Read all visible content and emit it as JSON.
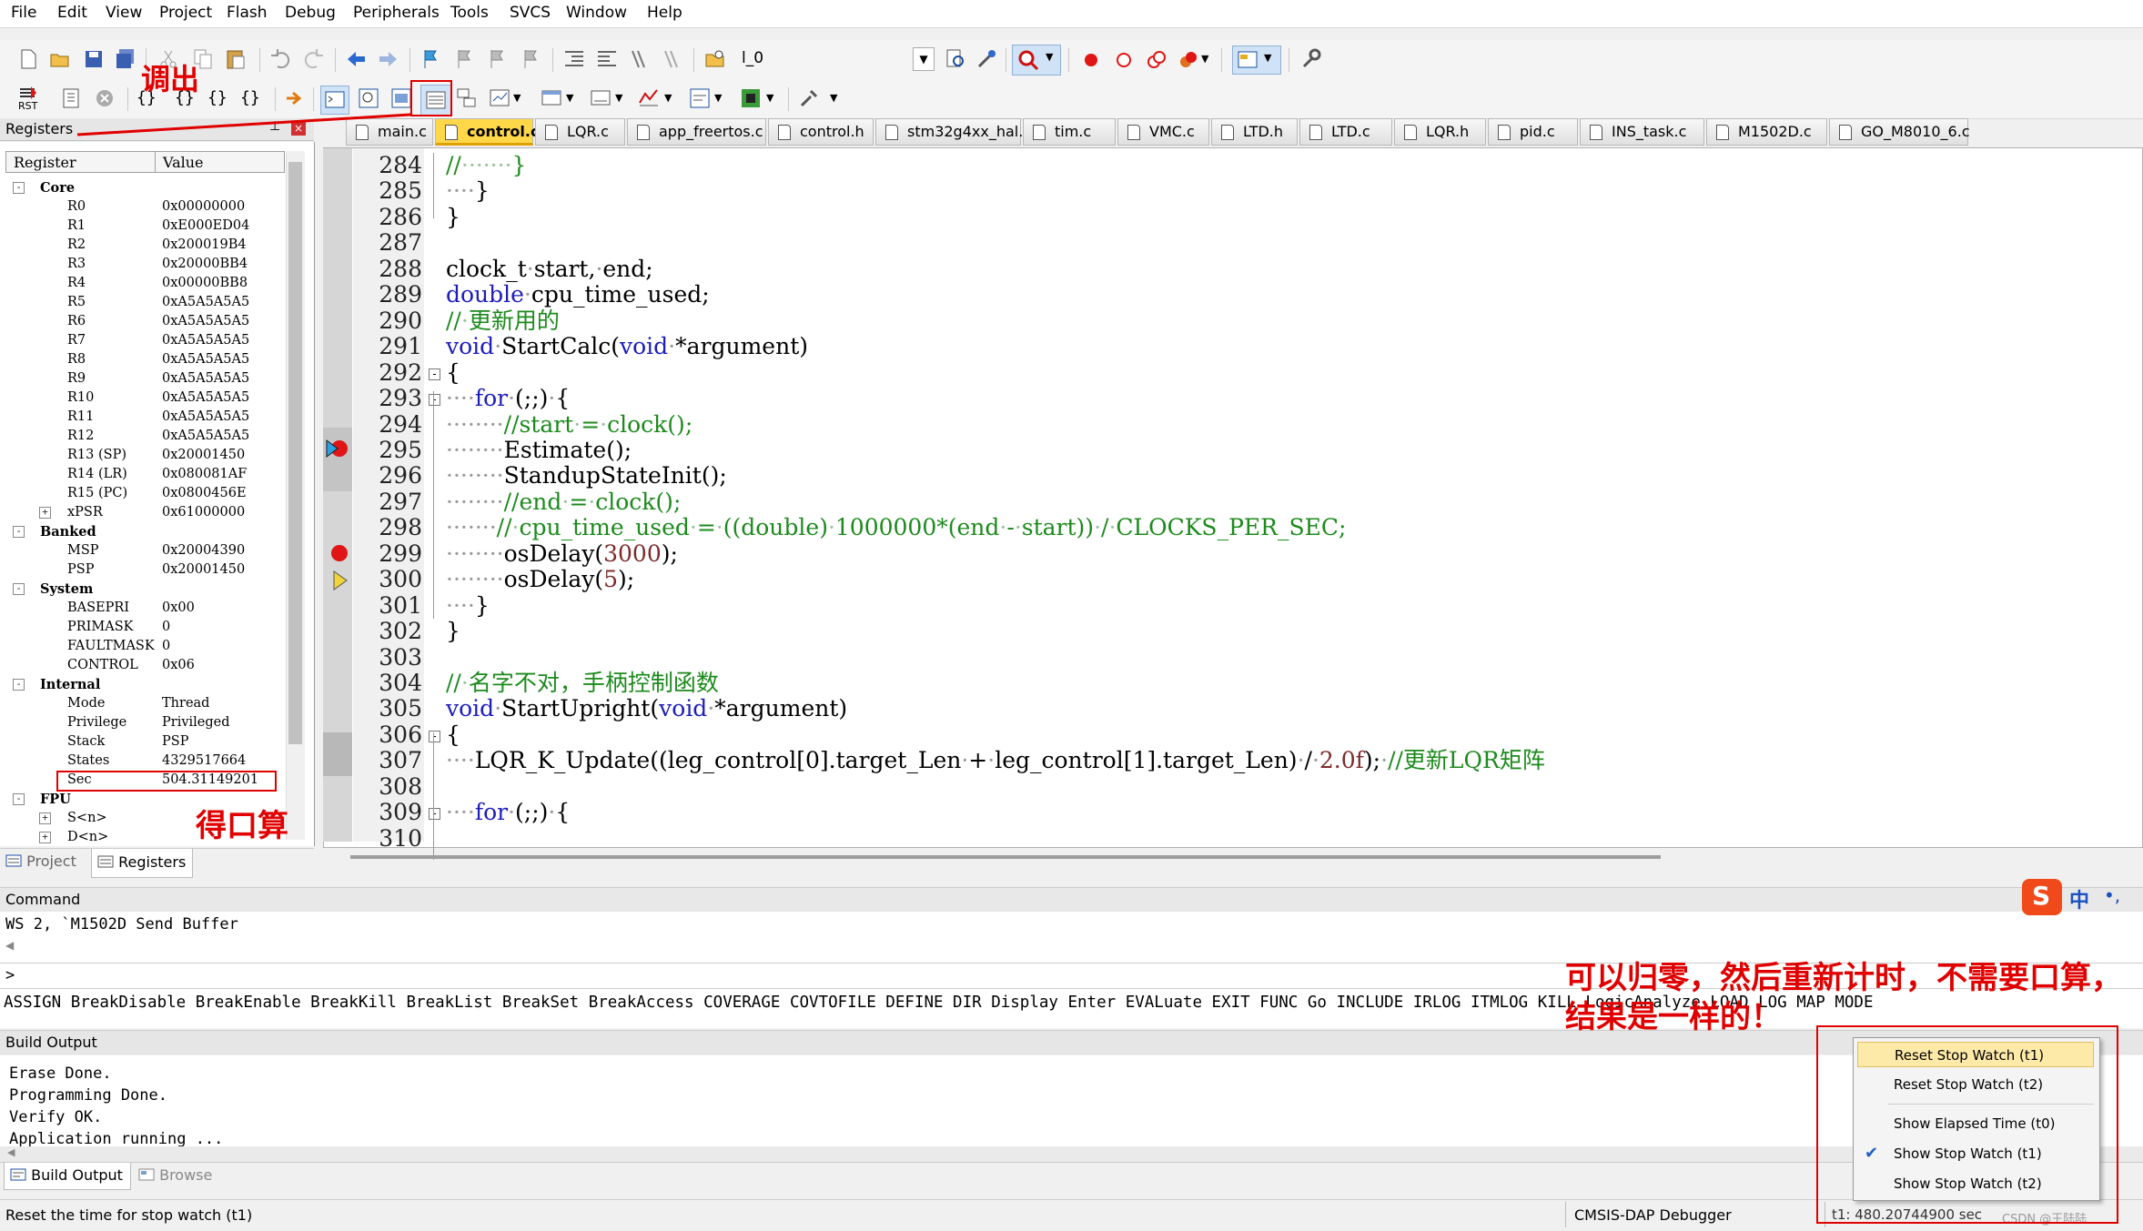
{
  "menu": [
    "File",
    "Edit",
    "View",
    "Project",
    "Flash",
    "Debug",
    "Peripherals",
    "Tools",
    "SVCS",
    "Window",
    "Help"
  ],
  "toolbar": {
    "target_value": "l_0",
    "rst_label": "RST"
  },
  "registers_panel": {
    "title": "Registers",
    "col_register": "Register",
    "col_value": "Value",
    "groups": [
      {
        "name": "Core"
      },
      {
        "name": "Banked"
      },
      {
        "name": "System"
      },
      {
        "name": "Internal"
      },
      {
        "name": "FPU"
      }
    ],
    "core": [
      {
        "name": "R0",
        "value": "0x00000000"
      },
      {
        "name": "R1",
        "value": "0xE000ED04"
      },
      {
        "name": "R2",
        "value": "0x200019B4"
      },
      {
        "name": "R3",
        "value": "0x20000BB4"
      },
      {
        "name": "R4",
        "value": "0x00000BB8"
      },
      {
        "name": "R5",
        "value": "0xA5A5A5A5"
      },
      {
        "name": "R6",
        "value": "0xA5A5A5A5"
      },
      {
        "name": "R7",
        "value": "0xA5A5A5A5"
      },
      {
        "name": "R8",
        "value": "0xA5A5A5A5"
      },
      {
        "name": "R9",
        "value": "0xA5A5A5A5"
      },
      {
        "name": "R10",
        "value": "0xA5A5A5A5"
      },
      {
        "name": "R11",
        "value": "0xA5A5A5A5"
      },
      {
        "name": "R12",
        "value": "0xA5A5A5A5"
      },
      {
        "name": "R13 (SP)",
        "value": "0x20001450"
      },
      {
        "name": "R14 (LR)",
        "value": "0x080081AF"
      },
      {
        "name": "R15 (PC)",
        "value": "0x0800456E"
      },
      {
        "name": "xPSR",
        "value": "0x61000000"
      }
    ],
    "banked": [
      {
        "name": "MSP",
        "value": "0x20004390"
      },
      {
        "name": "PSP",
        "value": "0x20001450"
      }
    ],
    "system": [
      {
        "name": "BASEPRI",
        "value": "0x00"
      },
      {
        "name": "PRIMASK",
        "value": "0"
      },
      {
        "name": "FAULTMASK",
        "value": "0"
      },
      {
        "name": "CONTROL",
        "value": "0x06"
      }
    ],
    "internal": [
      {
        "name": "Mode",
        "value": "Thread"
      },
      {
        "name": "Privilege",
        "value": "Privileged"
      },
      {
        "name": "Stack",
        "value": "PSP"
      },
      {
        "name": "States",
        "value": "4329517664"
      },
      {
        "name": "Sec",
        "value": "504.31149201"
      }
    ],
    "fpu": [
      {
        "name": "S<n>"
      },
      {
        "name": "D<n>"
      }
    ],
    "tabs": [
      "Project",
      "Registers"
    ]
  },
  "file_tabs": [
    "main.c",
    "control.c",
    "LQR.c",
    "app_freertos.c",
    "control.h",
    "stm32g4xx_hal.c",
    "tim.c",
    "VMC.c",
    "LTD.h",
    "LTD.c",
    "LQR.h",
    "pid.c",
    "INS_task.c",
    "M1502D.c",
    "GO_M8010_6.c"
  ],
  "editor": {
    "lines": [
      {
        "no": "284",
        "text": "//·······}"
      },
      {
        "no": "285",
        "text": "····}"
      },
      {
        "no": "286",
        "text": "}"
      },
      {
        "no": "287",
        "text": ""
      },
      {
        "no": "288",
        "text": "clock_t·start,·end;"
      },
      {
        "no": "289",
        "text": "double·cpu_time_used;"
      },
      {
        "no": "290",
        "text": "//·更新用的"
      },
      {
        "no": "291",
        "text": "void·StartCalc(void·*argument)"
      },
      {
        "no": "292",
        "text": "{"
      },
      {
        "no": "293",
        "text": "····for·(;;)·{"
      },
      {
        "no": "294",
        "text": "········//start·=·clock();"
      },
      {
        "no": "295",
        "text": "········Estimate();"
      },
      {
        "no": "296",
        "text": "········StandupStateInit();"
      },
      {
        "no": "297",
        "text": "········//end·=·clock();"
      },
      {
        "no": "298",
        "text": "·······//·cpu_time_used·=·((double)·1000000*(end·-·start))·/·CLOCKS_PER_SEC;"
      },
      {
        "no": "299",
        "text": "········osDelay(3000);"
      },
      {
        "no": "300",
        "text": "········osDelay(5);"
      },
      {
        "no": "301",
        "text": "····}"
      },
      {
        "no": "302",
        "text": "}"
      },
      {
        "no": "303",
        "text": ""
      },
      {
        "no": "304",
        "text": "//·名字不对，手柄控制函数"
      },
      {
        "no": "305",
        "text": "void·StartUpright(void·*argument)"
      },
      {
        "no": "306",
        "text": "{"
      },
      {
        "no": "307",
        "text": "····LQR_K_Update((leg_control[0].target_Len·+·leg_control[1].target_Len)·/·2.0f);·//更新LQR矩阵"
      },
      {
        "no": "308",
        "text": ""
      },
      {
        "no": "309",
        "text": "····for·(;;)·{"
      },
      {
        "no": "310",
        "text": ""
      }
    ]
  },
  "command": {
    "title": "Command",
    "output": "WS 2, `M1502D Send Buffer",
    "prompt": ">",
    "keywords": "ASSIGN BreakDisable BreakEnable BreakKill BreakList BreakSet BreakAccess COVERAGE COVTOFILE DEFINE DIR Display Enter EVALuate EXIT FUNC Go INCLUDE IRLOG ITMLOG KILL LogicAnalyze LOAD LOG MAP MODE"
  },
  "build_output": {
    "title": "Build Output",
    "lines": [
      "Erase Done.",
      "Programming Done.",
      "Verify OK.",
      "Application running ..."
    ],
    "tabs": [
      "Build Output",
      "Browse"
    ]
  },
  "context_menu": {
    "items": [
      {
        "label": "Reset Stop Watch (t1)",
        "highlighted": true,
        "checked": false
      },
      {
        "label": "Reset Stop Watch (t2)",
        "highlighted": false,
        "checked": false
      },
      {
        "label": "Show Elapsed Time (t0)",
        "highlighted": false,
        "checked": false
      },
      {
        "label": "Show Stop Watch (t1)",
        "highlighted": false,
        "checked": true
      },
      {
        "label": "Show Stop Watch (t2)",
        "highlighted": false,
        "checked": false
      }
    ]
  },
  "status": {
    "message": "Reset the time for stop watch (t1)",
    "debugger": "CMSIS-DAP Debugger",
    "stopwatch": "t1: 480.20744900 sec",
    "watermark": "CSDN @王陆陆"
  },
  "ime": {
    "lang": "中"
  },
  "annotations": {
    "call_out": "调出",
    "mental_math": "得口算",
    "note_line1": "可以归零，然后重新计时，不需要口算，",
    "note_line2": "结果是一样的！"
  },
  "colors": {
    "annotation_red": "#e00000",
    "keyword_blue": "#1d1dbb",
    "comment_green": "#1c8a1c",
    "active_tab": "#ffd84a",
    "tab_bg": "#e6e6e6"
  }
}
